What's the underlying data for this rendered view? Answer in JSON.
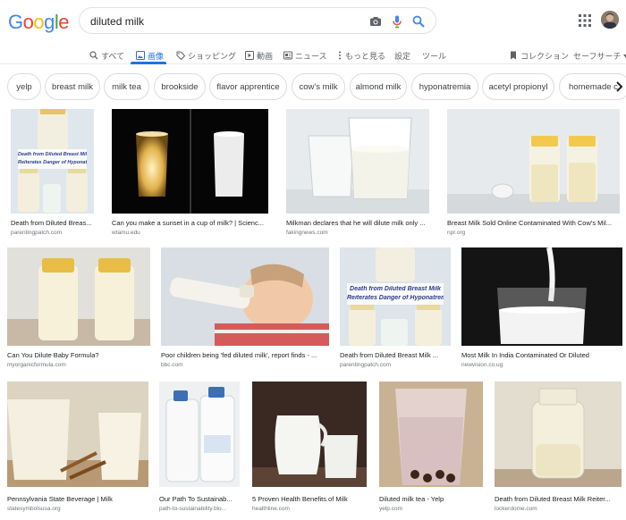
{
  "header": {
    "logo_letters": [
      "G",
      "o",
      "o",
      "g",
      "l",
      "e"
    ],
    "logo_colors": [
      "#4285F4",
      "#EA4335",
      "#FBBC05",
      "#4285F4",
      "#34A853",
      "#EA4335"
    ],
    "search_value": "diluted milk",
    "icons": [
      "camera-icon",
      "microphone-icon",
      "search-icon",
      "apps-icon"
    ]
  },
  "tabs": [
    {
      "label": "すべて",
      "icon": "search-icon"
    },
    {
      "label": "画像",
      "icon": "image-icon",
      "active": true
    },
    {
      "label": "ショッピング",
      "icon": "tag-icon"
    },
    {
      "label": "動画",
      "icon": "play-icon"
    },
    {
      "label": "ニュース",
      "icon": "news-icon"
    },
    {
      "label": "もっと見る",
      "icon": "more-icon"
    },
    {
      "label": "設定"
    },
    {
      "label": "ツール"
    }
  ],
  "tools_right": {
    "collection": "コレクション",
    "safesearch": "セーフサーチ"
  },
  "chips": [
    "yelp",
    "breast milk",
    "milk tea",
    "brookside",
    "flavor apprentice",
    "cow's milk",
    "almond milk",
    "hyponatremia",
    "acetyl propionyl",
    "homemade c"
  ],
  "results": [
    {
      "caption": "Death from Diluted Breas...",
      "source": "parentingpatch.com",
      "overlay": [
        "Death from Diluted Breast Milk",
        "Reiterates Danger of Hyponatremia"
      ]
    },
    {
      "caption": "Can you make a sunset in a cup of milk? | Scienc...",
      "source": "wtamu.edu"
    },
    {
      "caption": "Milkman declares that he will dilute milk only ...",
      "source": "fakingnews.com"
    },
    {
      "caption": "Breast Milk Sold Online Contaminated With Cow's Mil...",
      "source": "npr.org"
    },
    {
      "caption": "Can You Dilute Baby Formula?",
      "source": "myorganicformula.com"
    },
    {
      "caption": "Poor children being 'fed diluted milk', report finds - ...",
      "source": "bbc.com"
    },
    {
      "caption": "Death from Diluted Breast Milk ...",
      "source": "parentingpatch.com",
      "overlay": [
        "Death from Diluted Breast Milk",
        "Reiterates Danger of Hyponatremia"
      ]
    },
    {
      "caption": "Most Milk In India Contaminated Or Diluted",
      "source": "newvision.co.ug"
    },
    {
      "caption": "Pennsylvania State Beverage | Milk",
      "source": "statesymbolsusa.org"
    },
    {
      "caption": "Our Path To Sustainab...",
      "source": "path-to-sustainability.blo..."
    },
    {
      "caption": "5 Proven Health Benefits of Milk",
      "source": "healthline.com"
    },
    {
      "caption": "Diluted milk tea - Yelp",
      "source": "yelp.com"
    },
    {
      "caption": "Death from Diluted Breast Milk Reiter...",
      "source": "lockerdome.com"
    }
  ]
}
